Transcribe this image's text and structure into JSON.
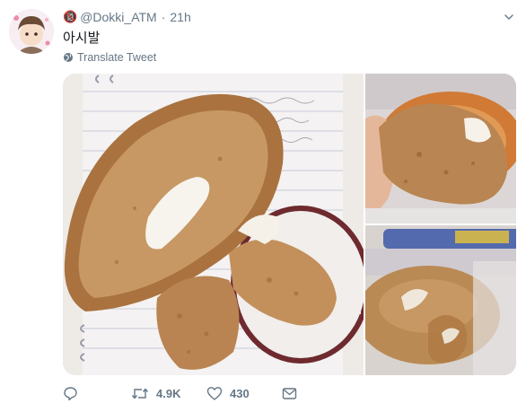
{
  "user": {
    "badge": "🔞",
    "handle": "@Dokki_ATM",
    "time_sep": "·",
    "time": "21h"
  },
  "tweet": {
    "text": "아시발",
    "translate_label": "Translate Tweet"
  },
  "photos": [
    {
      "name": "bread-photo-main"
    },
    {
      "name": "bread-photo-top-right"
    },
    {
      "name": "bread-photo-bottom-right"
    }
  ],
  "actions": {
    "reply_count": "",
    "retweet_count": "4.9K",
    "like_count": "430"
  },
  "colors": {
    "secondary_text": "#657786",
    "primary_text": "#14171a"
  }
}
